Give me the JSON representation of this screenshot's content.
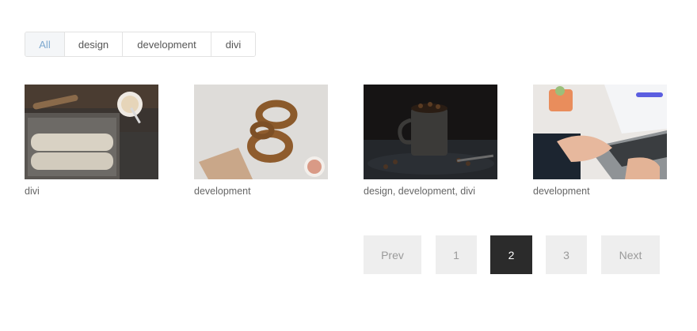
{
  "filters": [
    {
      "label": "All",
      "active": true
    },
    {
      "label": "design",
      "active": false
    },
    {
      "label": "development",
      "active": false
    },
    {
      "label": "divi",
      "active": false
    }
  ],
  "items": [
    {
      "caption": "divi",
      "image": "baking-dough-image"
    },
    {
      "caption": "development",
      "image": "pretzels-image"
    },
    {
      "caption": "design, development, divi",
      "image": "coffee-cup-image"
    },
    {
      "caption": "development",
      "image": "laptop-typing-image"
    }
  ],
  "pagination": {
    "prev_label": "Prev",
    "pages": [
      "1",
      "2",
      "3"
    ],
    "current": "2",
    "next_label": "Next"
  },
  "colors": {
    "active_filter_text": "#7ea9cf",
    "current_page_bg": "#2b2b2b",
    "page_button_bg": "#eeeeee"
  }
}
